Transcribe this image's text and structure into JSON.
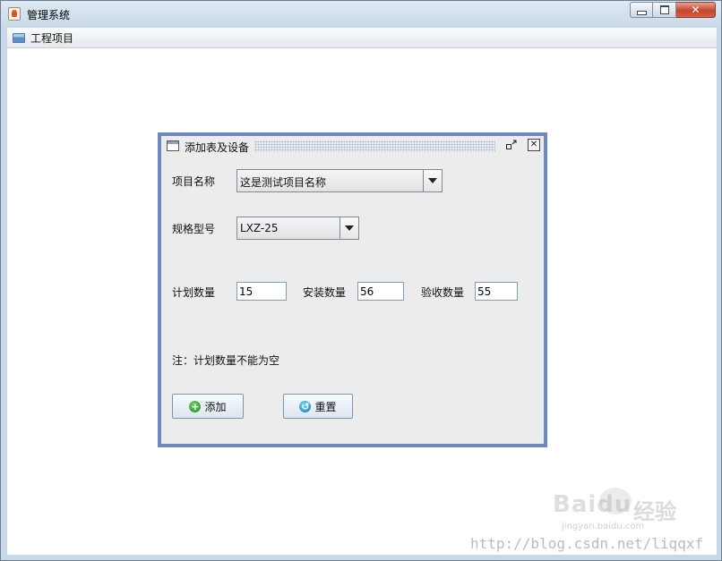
{
  "window": {
    "title": "管理系统"
  },
  "menubar": {
    "items": [
      {
        "label": "工程项目",
        "icon": "menu-list-icon"
      }
    ]
  },
  "dialog": {
    "title": "添加表及设备",
    "project_label": "项目名称",
    "project_value": "这是测试项目名称",
    "model_label": "规格型号",
    "model_value": "LXZ-25",
    "planned_label": "计划数量",
    "planned_value": "15",
    "installed_label": "安装数量",
    "installed_value": "56",
    "accepted_label": "验收数量",
    "accepted_value": "55",
    "note": "注：计划数量不能为空",
    "add_label": "添加",
    "reset_label": "重置"
  },
  "watermark": {
    "brand": "Baidu",
    "jingyan": "经验",
    "sub": "jingyan.baidu.com",
    "url": "http://blog.csdn.net/liqqxf"
  },
  "colors": {
    "frame_border": "#6e89bd",
    "close_red": "#c4452c"
  }
}
